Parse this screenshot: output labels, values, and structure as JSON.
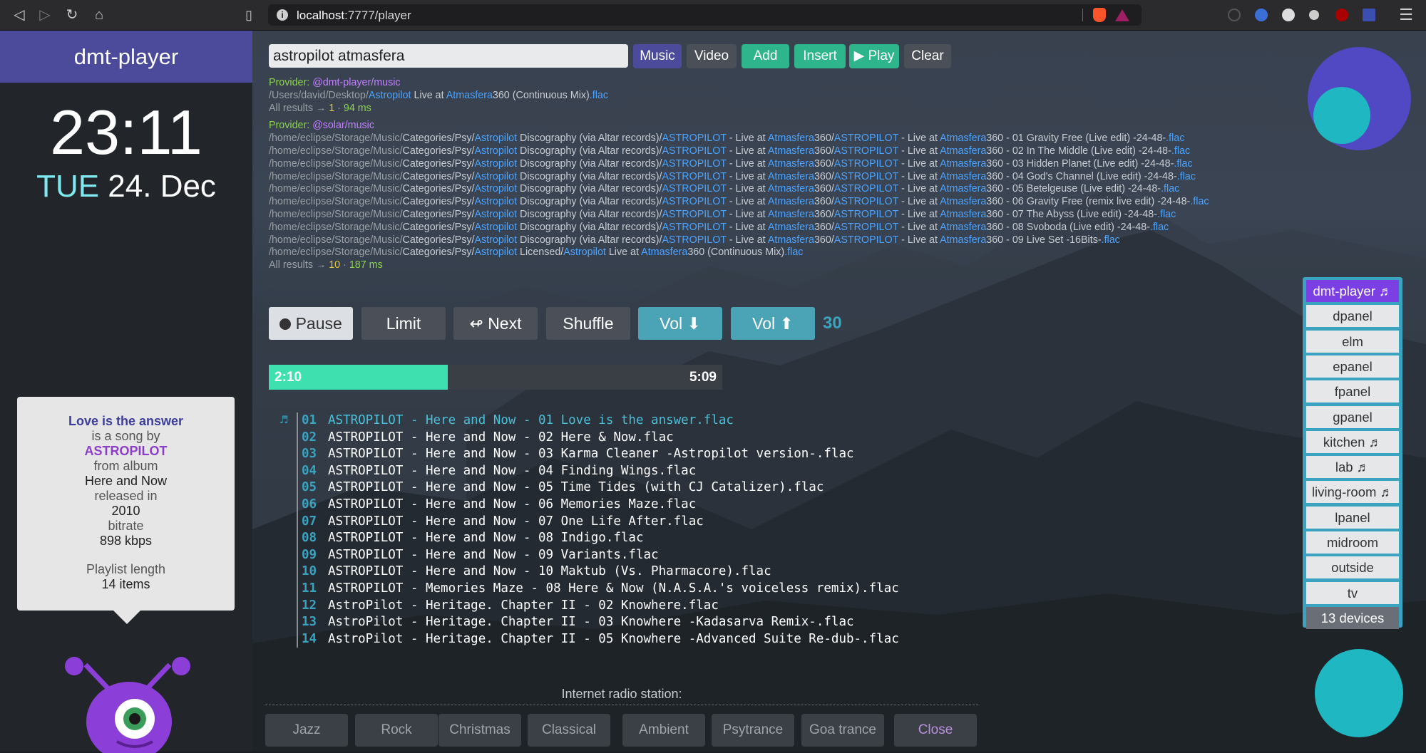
{
  "browser": {
    "url_host": "localhost",
    "url_rest": ":7777/player",
    "menu_glyph": "☰"
  },
  "sidebar": {
    "title": "dmt-player",
    "time": "23:11",
    "day": "TUE",
    "date": "24. Dec"
  },
  "info": {
    "song": "Love is the answer",
    "is_a_song_by": "is a song by",
    "artist": "ASTROPILOT",
    "from_album": "from album",
    "album": "Here and Now",
    "released_in": "released in",
    "year": "2010",
    "bitrate_label": "bitrate",
    "bitrate": "898 kbps",
    "playlist_label": "Playlist length",
    "playlist_length": "14 items"
  },
  "search": {
    "value": "astropilot atmasfera",
    "buttons": {
      "music": "Music",
      "video": "Video",
      "add": "Add",
      "insert": "Insert",
      "play": "▶ Play",
      "clear": "Clear"
    }
  },
  "results": {
    "provider_label": "Provider: ",
    "all_results": "All results → ",
    "provider1": {
      "name": "@dmt-player",
      "path": "/music",
      "file_dir": "/Users/david/Desktop/",
      "file_hi": "Astropilot",
      "file_mid": " Live at ",
      "file_hi2": "Atmasfera",
      "file_rest": "360 (Continuous Mix)",
      "file_ext": ".flac",
      "count": "1",
      "time": "94 ms"
    },
    "provider2": {
      "name": "@solar",
      "path": "/music",
      "count": "10",
      "time": "187 ms"
    },
    "rows": [
      "01 Gravity Free (Live edit) -24-48-",
      "02 In The Middle (Live edit) -24-48-",
      "03 Hidden Planet (Live edit) -24-48-",
      "04 God's Channel (Live edit) -24-48-",
      "05 Betelgeuse (Live edit) -24-48-",
      "06 Gravity Free (remix live edit) -24-48-",
      "07 The Abyss (Live edit) -24-48-",
      "08 Svoboda (Live edit) -24-48-",
      "09 Live Set -16Bits-"
    ],
    "last_row_end": " Live at "
  },
  "controls": {
    "pause": "Pause",
    "limit": "Limit",
    "next": "Next",
    "shuffle": "Shuffle",
    "vol_down": "Vol ⬇",
    "vol_up": "Vol ⬆",
    "volume": "30"
  },
  "progress": {
    "current": "2:10",
    "total": "5:09",
    "fraction": 0.3948
  },
  "playlist": [
    {
      "idx": "01",
      "name": "ASTROPILOT - Here and Now - 01 Love is the answer.flac",
      "current": true
    },
    {
      "idx": "02",
      "name": "ASTROPILOT - Here and Now - 02 Here & Now.flac"
    },
    {
      "idx": "03",
      "name": "ASTROPILOT - Here and Now - 03 Karma Cleaner -Astropilot version-.flac"
    },
    {
      "idx": "04",
      "name": "ASTROPILOT - Here and Now - 04 Finding Wings.flac"
    },
    {
      "idx": "05",
      "name": "ASTROPILOT - Here and Now - 05 Time Tides (with CJ Catalizer).flac"
    },
    {
      "idx": "06",
      "name": "ASTROPILOT - Here and Now - 06 Memories Maze.flac"
    },
    {
      "idx": "07",
      "name": "ASTROPILOT - Here and Now - 07 One Life After.flac"
    },
    {
      "idx": "08",
      "name": "ASTROPILOT - Here and Now - 08 Indigo.flac"
    },
    {
      "idx": "09",
      "name": "ASTROPILOT - Here and Now - 09 Variants.flac"
    },
    {
      "idx": "10",
      "name": "ASTROPILOT - Here and Now - 10 Maktub (Vs. Pharmacore).flac"
    },
    {
      "idx": "11",
      "name": "ASTROPILOT - Memories Maze - 08 Here & Now (N.A.S.A.'s voiceless remix).flac"
    },
    {
      "idx": "12",
      "name": "AstroPilot - Heritage. Chapter II - 02 Knowhere.flac"
    },
    {
      "idx": "13",
      "name": "AstroPilot - Heritage. Chapter II - 03 Knowhere -Kadasarva Remix-.flac"
    },
    {
      "idx": "14",
      "name": "AstroPilot - Heritage. Chapter II - 05 Knowhere -Advanced Suite Re-dub-.flac"
    }
  ],
  "radio": {
    "label": "Internet radio station:",
    "stations": [
      "Jazz",
      "Rock",
      "Christmas",
      "Classical",
      "Ambient",
      "Psytrance",
      "Goa trance"
    ],
    "close": "Close"
  },
  "devices": {
    "items": [
      "dmt-player ♬",
      "dpanel",
      "elm",
      "epanel",
      "fpanel",
      "gpanel",
      "kitchen ♬",
      "lab ♬",
      "living-room ♬",
      "lpanel",
      "midroom",
      "outside",
      "tv"
    ],
    "count": "13 devices"
  },
  "colors": {
    "accent_purple": "#4b4a9b",
    "accent_teal": "#3aa3c0",
    "progress_fill": "#3fe0b0",
    "add_green": "#2fb58c"
  }
}
